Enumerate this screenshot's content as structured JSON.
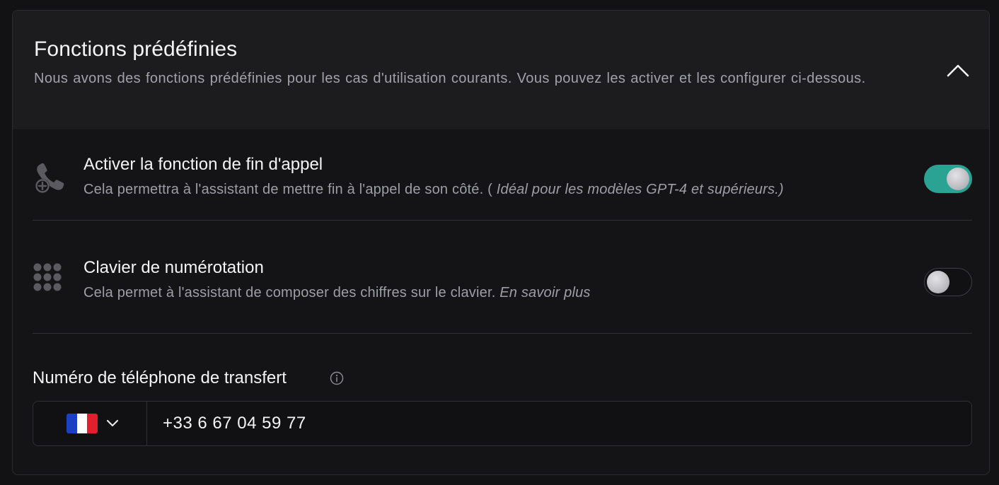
{
  "section": {
    "title": "Fonctions prédéfinies",
    "description": "Nous avons des fonctions prédéfinies pour les cas d'utilisation courants. Vous pouvez les activer et les configurer ci-dessous.",
    "collapse_icon": "chevron-up-icon"
  },
  "functions": [
    {
      "icon": "phone-end-call-icon",
      "title": "Activer la fonction de fin d'appel",
      "description": "Cela permettra à l'assistant de mettre fin à l'appel de son côté. ( ",
      "description_emphasis": "Idéal pour les modèles GPT-4 et supérieurs.)",
      "enabled": true
    },
    {
      "icon": "dialpad-icon",
      "title": "Clavier de numérotation",
      "description": "Cela permet à l'assistant de composer des chiffres sur le clavier. ",
      "description_emphasis": "En savoir plus",
      "enabled": false
    }
  ],
  "transfer": {
    "label": "Numéro de téléphone de transfert",
    "info_icon": "info-icon",
    "country_flag": "france-flag-icon",
    "phone_number": "+33 6 67 04 59 77"
  },
  "colors": {
    "toggle_on": "#2aa394",
    "background": "#141416",
    "header_background": "#1c1c1f"
  }
}
